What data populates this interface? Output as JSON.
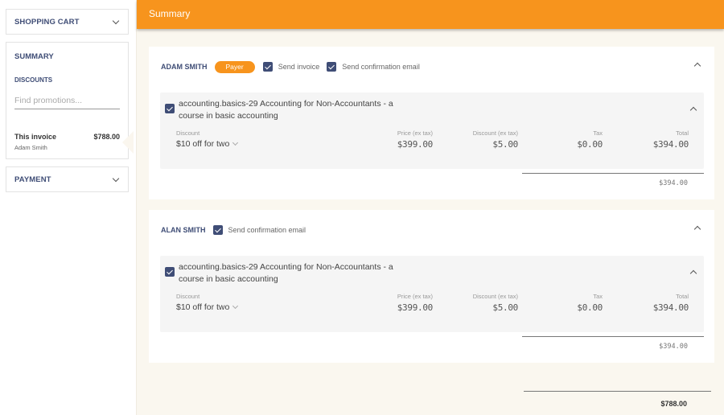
{
  "sidebar": {
    "shopping_cart_label": "SHOPPING CART",
    "summary_label": "SUMMARY",
    "discounts_label": "DISCOUNTS",
    "promo_placeholder": "Find promotions...",
    "promo_value": "",
    "invoice": {
      "label": "This invoice",
      "amount": "$788.00",
      "name": "Adam Smith"
    },
    "payment_label": "PAYMENT"
  },
  "header": {
    "title": "Summary",
    "accent_color": "#f7941d"
  },
  "invoices": [
    {
      "name": "ADAM SMITH",
      "badge": "Payer",
      "options": [
        {
          "label": "Send invoice",
          "checked": true
        },
        {
          "label": "Send confirmation email",
          "checked": true
        }
      ],
      "item": {
        "checked": true,
        "title": "accounting.basics-29 Accounting for Non-Accountants - a course in basic accounting",
        "discount_label": "Discount",
        "discount_value": "$10 off for two",
        "price_label": "Price (ex tax)",
        "price": "$399.00",
        "discount_ex_label": "Discount (ex tax)",
        "discount_ex": "$5.00",
        "tax_label": "Tax",
        "tax": "$0.00",
        "total_label": "Total",
        "total": "$394.00"
      },
      "subtotal": "$394.00"
    },
    {
      "name": "ALAN SMITH",
      "options": [
        {
          "label": "Send confirmation email",
          "checked": true
        }
      ],
      "item": {
        "checked": true,
        "title": "accounting.basics-29 Accounting for Non-Accountants - a course in basic accounting",
        "discount_label": "Discount",
        "discount_value": "$10 off for two",
        "price_label": "Price (ex tax)",
        "price": "$399.00",
        "discount_ex_label": "Discount (ex tax)",
        "discount_ex": "$5.00",
        "tax_label": "Tax",
        "tax": "$0.00",
        "total_label": "Total",
        "total": "$394.00"
      },
      "subtotal": "$394.00"
    }
  ],
  "grand_total": "$788.00"
}
